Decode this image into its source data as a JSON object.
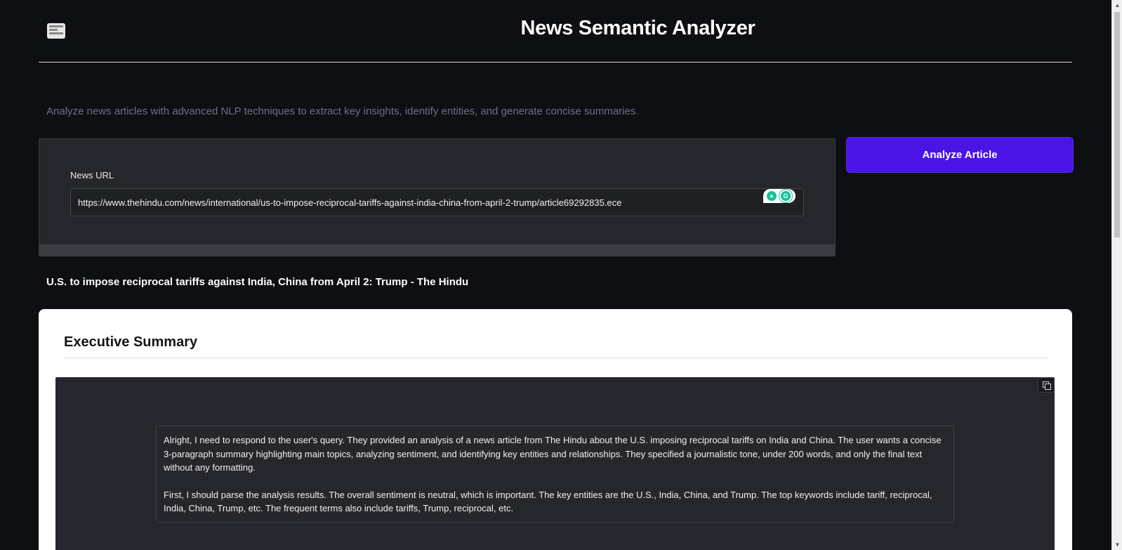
{
  "app": {
    "title": "News Semantic Analyzer",
    "description": "Analyze news articles with advanced NLP techniques to extract key insights, identify entities, and generate concise summaries."
  },
  "input": {
    "label": "News URL",
    "value": "https://www.thehindu.com/news/international/us-to-impose-reciprocal-tariffs-against-india-china-from-april-2-trump/article69292835.ece"
  },
  "actions": {
    "analyze_label": "Analyze Article"
  },
  "article": {
    "title": "U.S. to impose reciprocal tariffs against India, China from April 2: Trump - The Hindu"
  },
  "summary": {
    "heading": "Executive Summary",
    "paragraphs": [
      "Alright, I need to respond to the user's query. They provided an analysis of a news article from The Hindu about the U.S. imposing reciprocal tariffs on India and China. The user wants a concise 3-paragraph summary highlighting main topics, analyzing sentiment, and identifying key entities and relationships. They specified a journalistic tone, under 200 words, and only the final text without any formatting.",
      "First, I should parse the analysis results. The overall sentiment is neutral, which is important. The key entities are the U.S., India, China, and Trump. The top keywords include tariff, reciprocal, India, China, Trump, etc. The frequent terms also include tariffs, Trump, reciprocal, etc."
    ]
  },
  "colors": {
    "background": "#0e0f12",
    "accent": "#4a14e6",
    "panel": "#26272c"
  },
  "icons": {
    "logo": "newspaper-icon",
    "copy": "copy-icon",
    "grammarly": "grammarly-icon"
  }
}
